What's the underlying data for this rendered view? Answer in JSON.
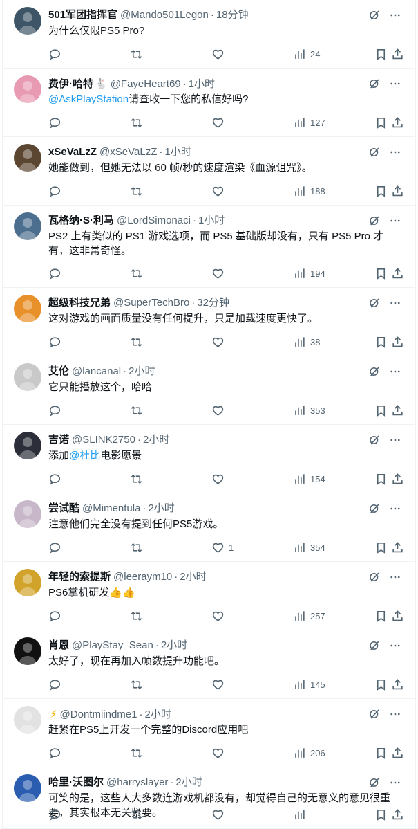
{
  "tweets": [
    {
      "name": "501军团指挥官",
      "handle": "@Mando501Legon",
      "time": "18分钟",
      "parts": [
        {
          "t": "为什么仅限PS5 Pro?"
        }
      ],
      "reply_count": "",
      "retweet_count": "",
      "like_count": "",
      "view_count": "24",
      "avatar_color": "#3d5566"
    },
    {
      "name": "费伊·哈特",
      "name_icon": "🐇",
      "handle": "@FayeHeart69",
      "time": "1小时",
      "parts": [
        {
          "t": "@AskPlayStation",
          "mention": true
        },
        {
          "t": "请查收一下您的私信好吗?"
        }
      ],
      "reply_count": "",
      "retweet_count": "",
      "like_count": "",
      "view_count": "127",
      "avatar_color": "#e79ab2"
    },
    {
      "name": "xSeVaLzZ",
      "handle": "@xSeVaLzZ",
      "time": "1小时",
      "parts": [
        {
          "t": "她能做到，但她无法以 60 帧/秒的速度渲染《血源诅咒》。"
        }
      ],
      "reply_count": "",
      "retweet_count": "",
      "like_count": "",
      "view_count": "188",
      "avatar_color": "#5b4632"
    },
    {
      "name": "瓦格纳·S·利马",
      "handle": "@LordSimonaci",
      "time": "1小时",
      "parts": [
        {
          "t": "PS2 上有类似的 PS1 游戏选项，而 PS5 基础版却没有，只有 PS5 Pro 才有，这非常奇怪。"
        }
      ],
      "reply_count": "",
      "retweet_count": "",
      "like_count": "",
      "view_count": "194",
      "avatar_color": "#4d6f8f"
    },
    {
      "name": "超级科技兄弟",
      "handle": "@SuperTechBro",
      "time": "32分钟",
      "parts": [
        {
          "t": "这对游戏的画面质量没有任何提升，只是加载速度更快了。"
        }
      ],
      "reply_count": "",
      "retweet_count": "",
      "like_count": "",
      "view_count": "38",
      "avatar_color": "#e8902a"
    },
    {
      "name": "艾伦",
      "handle": "@lancanal",
      "time": "2小时",
      "parts": [
        {
          "t": "它只能播放这个，哈哈"
        }
      ],
      "reply_count": "",
      "retweet_count": "",
      "like_count": "",
      "view_count": "353",
      "avatar_color": "#c9c9c9"
    },
    {
      "name": "吉诺",
      "handle": "@SLINK2750",
      "time": "2小时",
      "parts": [
        {
          "t": "添加"
        },
        {
          "t": "@杜比",
          "mention": true
        },
        {
          "t": "电影愿景"
        }
      ],
      "reply_count": "",
      "retweet_count": "",
      "like_count": "",
      "view_count": "154",
      "avatar_color": "#2c2f3a"
    },
    {
      "name": "尝试酷",
      "handle": "@Mimentula",
      "time": "2小时",
      "parts": [
        {
          "t": "注意他们完全没有提到任何PS5游戏。"
        }
      ],
      "reply_count": "",
      "retweet_count": "",
      "like_count": "1",
      "view_count": "354",
      "avatar_color": "#c7b7c9"
    },
    {
      "name": "年轻的索提斯",
      "handle": "@leeraym10",
      "time": "2小时",
      "parts": [
        {
          "t": "PS6掌机研发"
        },
        {
          "t": "👍👍",
          "emoji": true
        }
      ],
      "reply_count": "",
      "retweet_count": "",
      "like_count": "",
      "view_count": "257",
      "avatar_color": "#d2a32a"
    },
    {
      "name": "肖恩",
      "handle": "@PlayStay_Sean",
      "time": "2小时",
      "parts": [
        {
          "t": "太好了，现在再加入帧数提升功能吧。"
        }
      ],
      "reply_count": "",
      "retweet_count": "",
      "like_count": "",
      "view_count": "145",
      "avatar_color": "#111111"
    },
    {
      "name": "",
      "name_icon": "⚡",
      "handle": "@Dontmiindme1",
      "time": "2小时",
      "parts": [
        {
          "t": "赶紧在PS5上开发一个完整的Discord应用吧"
        }
      ],
      "reply_count": "",
      "retweet_count": "",
      "like_count": "",
      "view_count": "206",
      "avatar_color": "#e2e2e2"
    },
    {
      "name": "哈里·沃图尔",
      "handle": "@harryslayer",
      "time": "2小时",
      "parts": [
        {
          "t": "可笑的是，这些人大多数连游戏机都没有，却觉得自己的无意义的意见很重要，其实根本无关紧要。"
        }
      ],
      "reply_count": "",
      "retweet_count": "",
      "like_count": "",
      "view_count": "",
      "avatar_color": "#2a5db0"
    }
  ],
  "icons": {
    "avatar": "avatar-image",
    "grok": "grok-icon",
    "more": "more-icon",
    "reply": "reply-icon",
    "retweet": "retweet-icon",
    "like": "like-icon",
    "views": "views-icon",
    "bookmark": "bookmark-icon",
    "share": "share-icon"
  },
  "colors": {
    "text": "#0f1419",
    "secondary": "#536471",
    "mention": "#1d9bf0",
    "divider": "#eff3f4"
  }
}
